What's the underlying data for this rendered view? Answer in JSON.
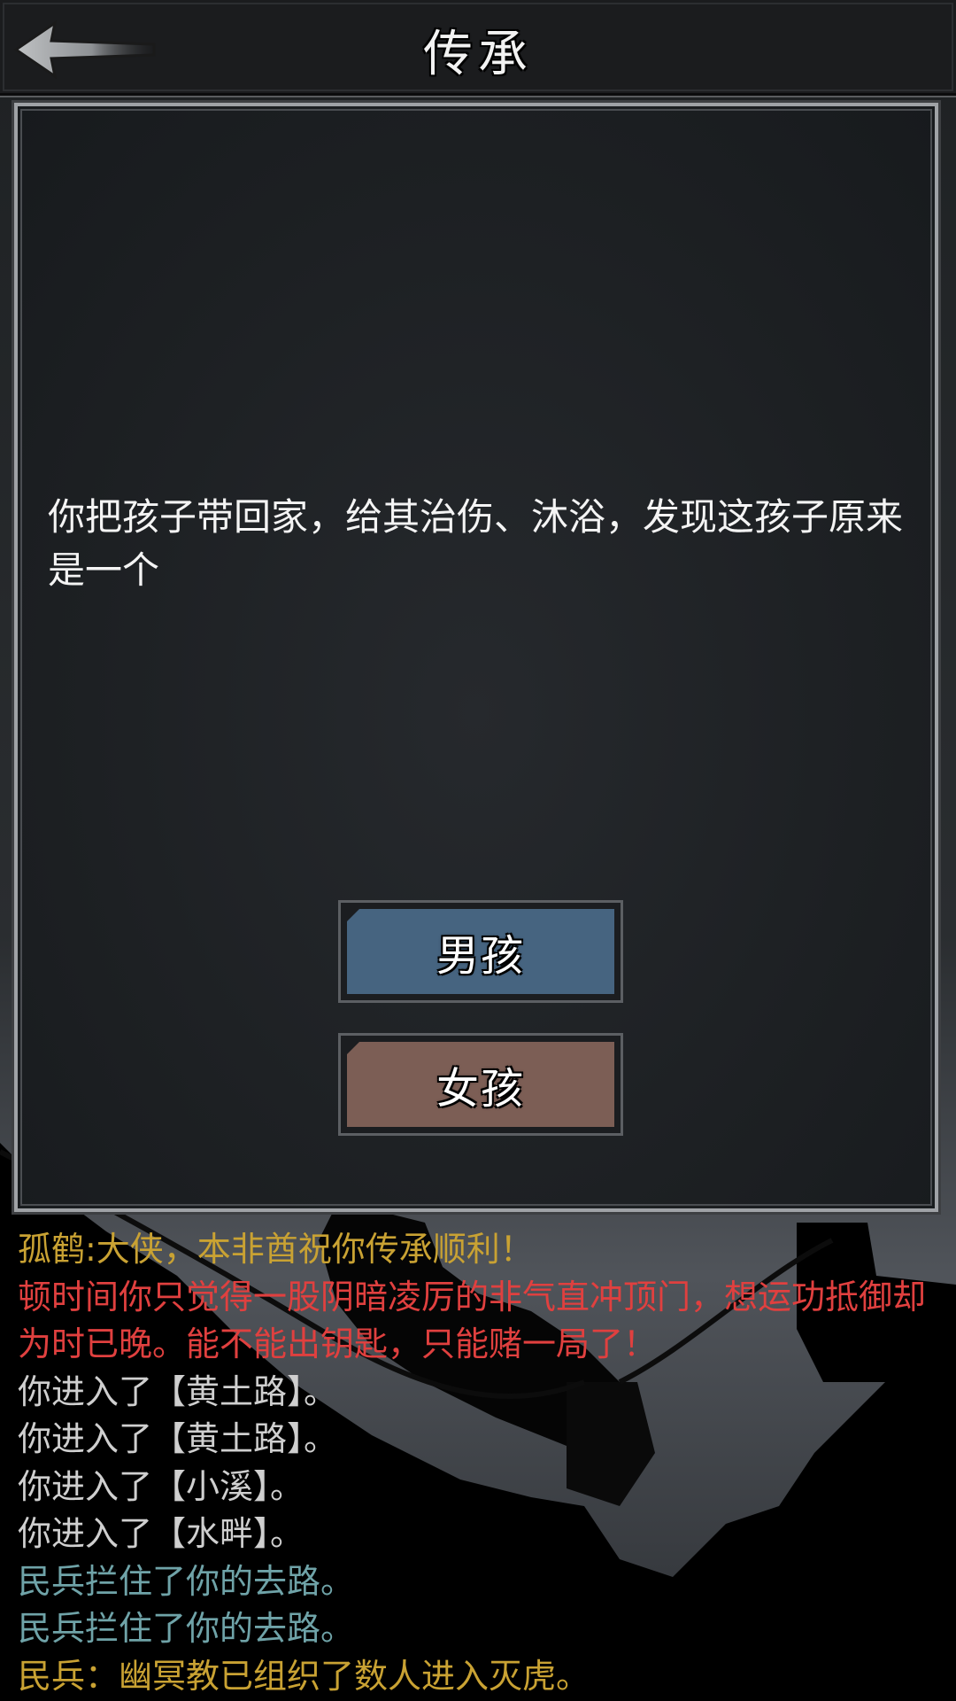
{
  "header": {
    "title": "传承",
    "back_icon": "back-arrow-icon"
  },
  "story": {
    "text": "你把孩子带回家，给其治伤、沐浴，发现这孩子原来是一个"
  },
  "choices": [
    {
      "label": "男孩",
      "color": "#466480"
    },
    {
      "label": "女孩",
      "color": "#7c5e55"
    }
  ],
  "log": [
    {
      "text": "孤鹤:大侠，本非酋祝你传承顺利！",
      "color": "#c9a233"
    },
    {
      "text": "顿时间你只觉得一股阴暗凌厉的非气直冲顶门，想运功抵御却为时已晚。能不能出钥匙，只能赌一局了！",
      "color": "#e0403f"
    },
    {
      "text": "你进入了【黄土路】。",
      "color": "#cfcfcf"
    },
    {
      "text": "你进入了【黄土路】。",
      "color": "#cfcfcf"
    },
    {
      "text": "你进入了【小溪】。",
      "color": "#cfcfcf"
    },
    {
      "text": "你进入了【水畔】。",
      "color": "#cfcfcf"
    },
    {
      "text": "民兵拦住了你的去路。",
      "color": "#6fa3a8"
    },
    {
      "text": "民兵拦住了你的去路。",
      "color": "#6fa3a8"
    },
    {
      "text": "民兵：幽冥教已组织了数人进入灭虎。",
      "color": "#c9a233"
    }
  ]
}
